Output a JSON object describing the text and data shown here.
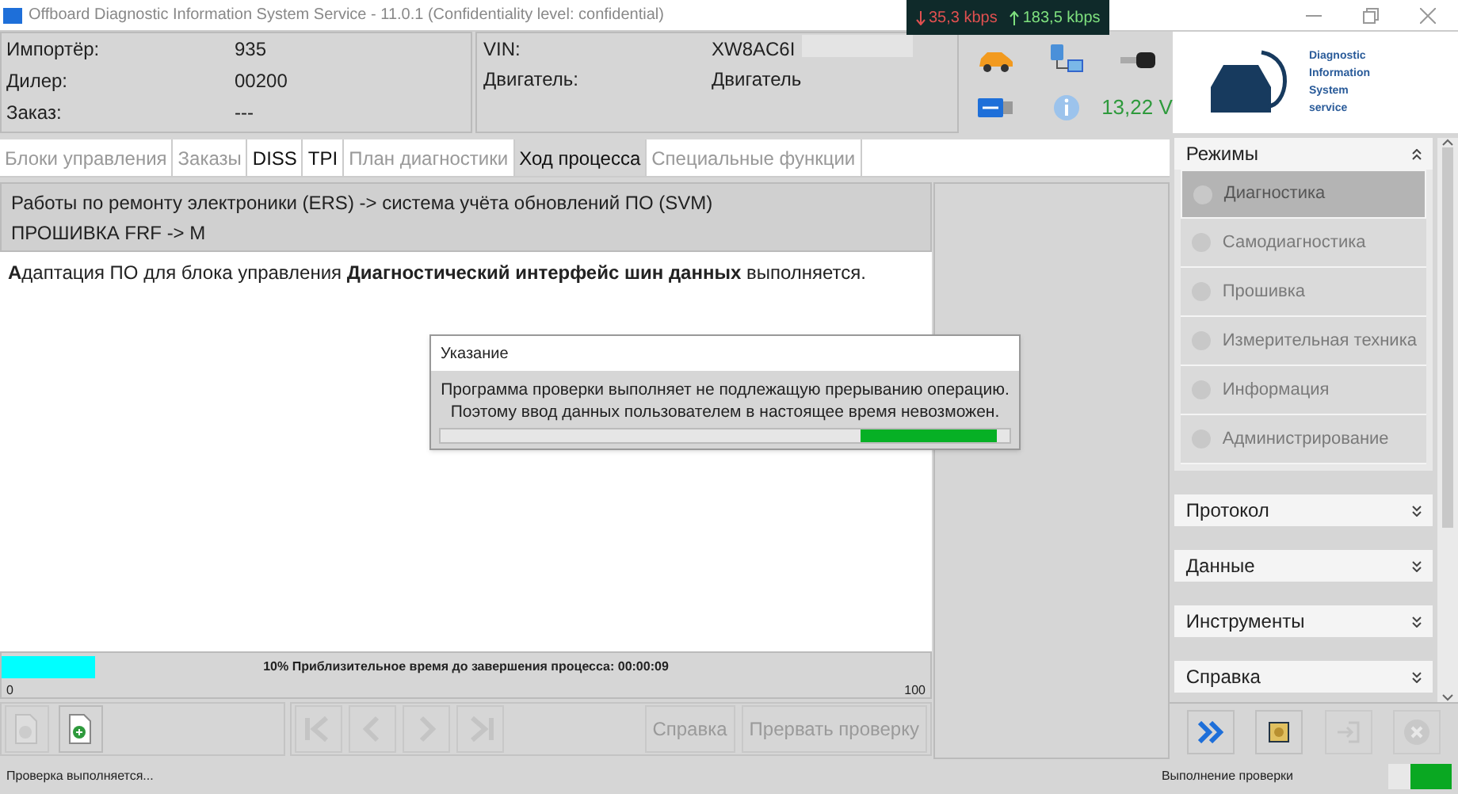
{
  "window": {
    "title": "Offboard Diagnostic Information System Service - 11.0.1 (Confidentiality level: confidential)"
  },
  "network_meter": {
    "download": "35,3 kbps",
    "upload": "183,5 kbps"
  },
  "header": {
    "left": [
      {
        "label": "Импортёр:",
        "value": "935"
      },
      {
        "label": "Дилер:",
        "value": "00200"
      },
      {
        "label": "Заказ:",
        "value": "---"
      }
    ],
    "right": [
      {
        "label": "VIN:",
        "value": "XW8AC6I"
      },
      {
        "label": "Двигатель:",
        "value": "Двигатель"
      }
    ],
    "voltage": "13,22 V"
  },
  "logo": {
    "lines": [
      "Diagnostic",
      "Information",
      "System",
      "service"
    ]
  },
  "tabs": [
    {
      "label": "Блоки управления",
      "selected": false,
      "disabled": true
    },
    {
      "label": "Заказы",
      "selected": false,
      "disabled": true
    },
    {
      "label": "DISS",
      "selected": false,
      "disabled": false
    },
    {
      "label": "TPI",
      "selected": false,
      "disabled": false
    },
    {
      "label": "План диагностики",
      "selected": false,
      "disabled": true
    },
    {
      "label": "Ход процесса",
      "selected": true,
      "disabled": false
    },
    {
      "label": "Специальные функции",
      "selected": false,
      "disabled": true
    }
  ],
  "breadcrumb": [
    "Работы по ремонту электроники (ERS) -> система учёта обновлений ПО (SVM)",
    "ПРОШИВКА FRF -> M"
  ],
  "message": "**А**даптация ПО для блока управления **Диагностический интерфейс шин данных** выполняется.",
  "dialog": {
    "title": "Указание",
    "lines": [
      "Программа проверки выполняет не подлежащую прерыванию операцию.",
      "Поэтому ввод данных пользователем в настоящее время невозможен."
    ]
  },
  "progress": {
    "level": 0.1,
    "label": "10% Приблизительное время до завершения процесса: 00:00:09",
    "min": "0",
    "max": "100"
  },
  "toolbar": {
    "buttons": [
      {
        "label": "Справка",
        "disabled": true
      },
      {
        "label": "Прервать проверку",
        "disabled": true
      }
    ]
  },
  "sidebar": {
    "sections": [
      {
        "title": "Режимы",
        "expanded": true,
        "items": [
          {
            "label": "Диагностика",
            "selected": true,
            "disabled": true
          },
          {
            "label": "Самодиагностика",
            "selected": false,
            "disabled": true
          },
          {
            "label": "Прошивка",
            "selected": false,
            "disabled": true
          },
          {
            "label": "Измерительная техника",
            "selected": false,
            "disabled": true
          },
          {
            "label": "Информация",
            "selected": false,
            "disabled": true
          },
          {
            "label": "Администрирование",
            "selected": false,
            "disabled": true
          }
        ]
      },
      {
        "title": "Протокол",
        "expanded": false
      },
      {
        "title": "Данные",
        "expanded": false
      },
      {
        "title": "Инструменты",
        "expanded": false
      },
      {
        "title": "Справка",
        "expanded": false
      }
    ]
  },
  "status_bar": {
    "left": "Проверка выполняется...",
    "right": "Выполнение проверки"
  }
}
